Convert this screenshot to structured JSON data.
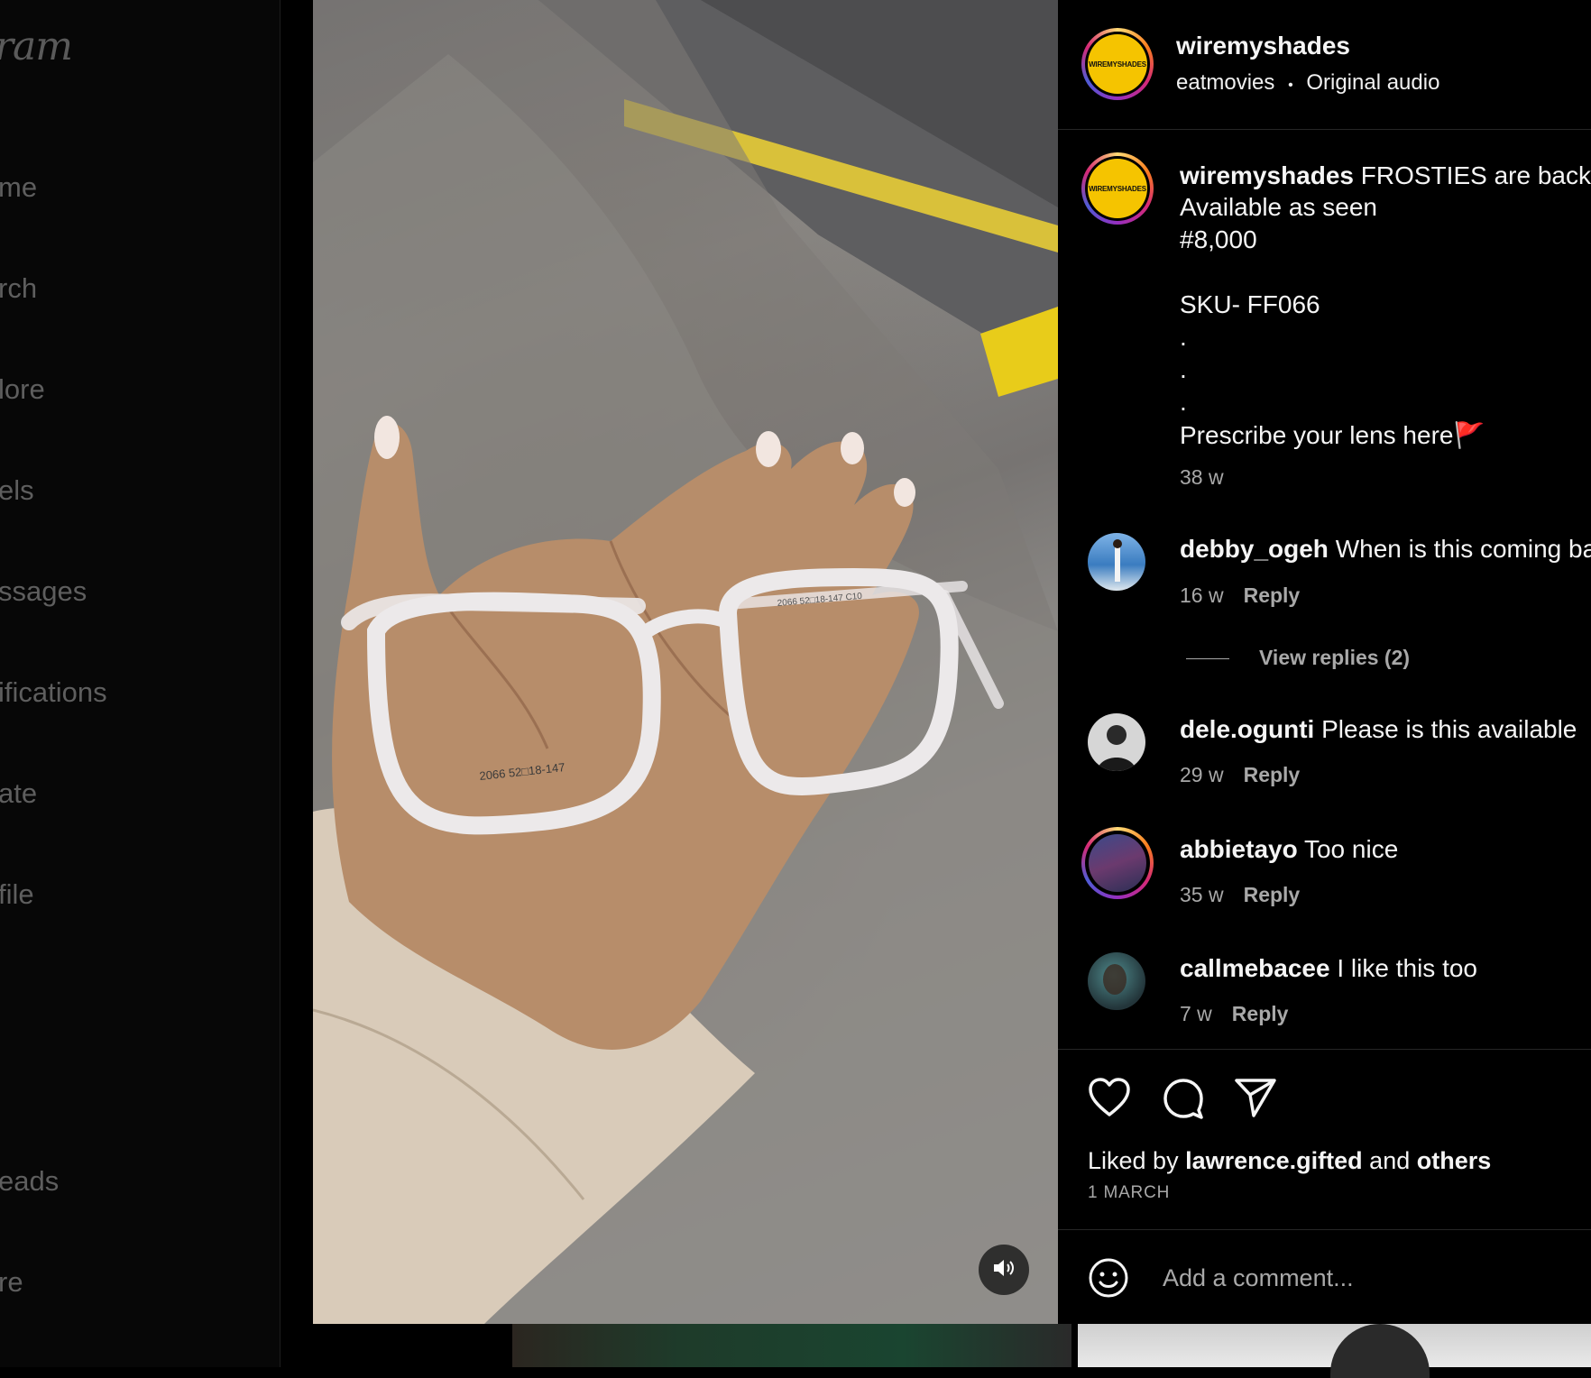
{
  "sidebar": {
    "logo": "ram",
    "items": [
      "me",
      "rch",
      "lore",
      "els",
      "ssages",
      "ifications",
      "ate",
      "file",
      "eads",
      "re"
    ]
  },
  "video": {
    "frame_text": "2066 52□18-147",
    "temple_text": "2066 52□18-147 C10",
    "mute_icon": "speaker-icon"
  },
  "post": {
    "author": "wiremyshades",
    "audio_artist": "eatmovies",
    "audio_separator": "•",
    "audio_label": "Original audio",
    "avatar_text": "WIREMYSHADES",
    "caption": {
      "username": "wiremyshades",
      "lines": [
        "FROSTIES are back🔥",
        "Available as seen",
        "#8,000",
        "",
        "SKU- FF066",
        ".",
        ".",
        ".",
        "Prescribe your lens here🚩"
      ],
      "age": "38 w"
    },
    "comments": [
      {
        "user": "debby_ogeh",
        "text": "When is this coming back",
        "age": "16 w",
        "reply": "Reply",
        "view_replies": "View replies (2)"
      },
      {
        "user": "dele.ogunti",
        "text": "Please is this available",
        "age": "29 w",
        "reply": "Reply"
      },
      {
        "user": "abbietayo",
        "text": "Too nice",
        "age": "35 w",
        "reply": "Reply"
      },
      {
        "user": "callmebacee",
        "text": "I like this too",
        "age": "7 w",
        "reply": "Reply"
      }
    ],
    "liked_prefix": "Liked by",
    "liked_user": "lawrence.gifted",
    "liked_and": "and",
    "liked_others": "others",
    "date": "1 MARCH",
    "add_comment_placeholder": "Add a comment..."
  },
  "colors": {
    "background": "#000000",
    "secondary_text": "#a8a8a8",
    "brand_yellow": "#f5c400"
  }
}
